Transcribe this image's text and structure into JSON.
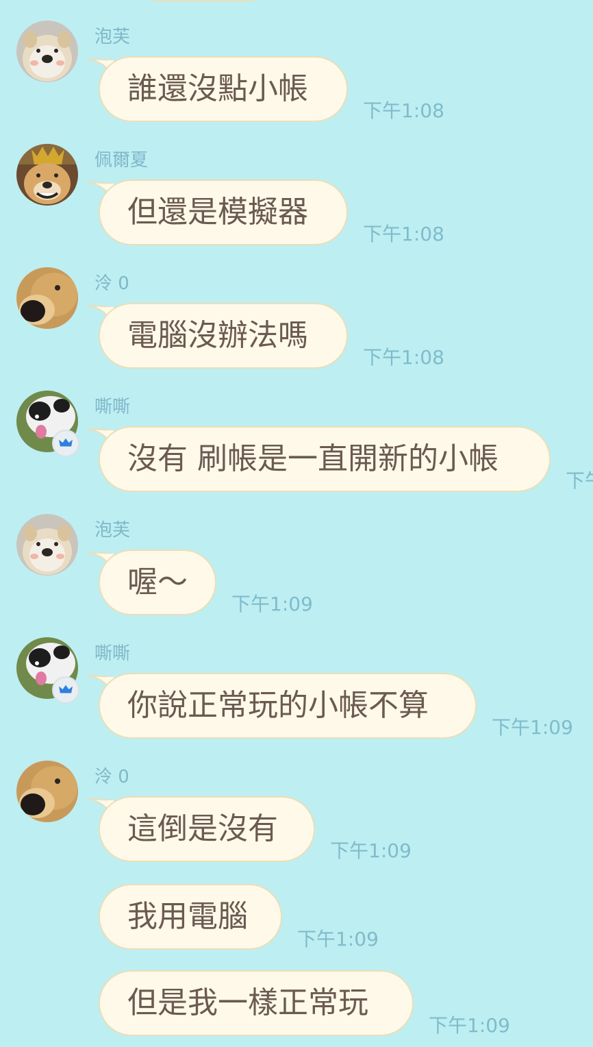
{
  "messages": [
    {
      "sender": "泡芙",
      "text": "誰還沒點小帳",
      "time": "下午1:08",
      "avatar": "dog-bread-avatar"
    },
    {
      "sender": "佩爾夏",
      "text": "但還是模擬器",
      "time": "下午1:08",
      "avatar": "dog-crown-avatar"
    },
    {
      "sender": "泠 0",
      "text": "電腦沒辦法嗎",
      "time": "下午1:08",
      "avatar": "dog-nose-avatar"
    },
    {
      "sender": "嘶嘶",
      "text": "沒有 刷帳是一直開新的小帳",
      "time": "下午",
      "avatar": "dog-bw-avatar",
      "badge": "crown-icon"
    },
    {
      "sender": "泡芙",
      "text": "喔～",
      "time": "下午1:09",
      "avatar": "dog-bread-avatar"
    },
    {
      "sender": "嘶嘶",
      "text": "你說正常玩的小帳不算",
      "time": "下午1:09",
      "avatar": "dog-bw-avatar",
      "badge": "crown-icon"
    },
    {
      "sender": "泠 0",
      "text": "這倒是沒有",
      "time": "下午1:09",
      "avatar": "dog-nose-avatar"
    },
    {
      "sender": "",
      "text": "我用電腦",
      "time": "下午1:09"
    },
    {
      "sender": "",
      "text": "但是我一樣正常玩",
      "time": "下午1:09"
    }
  ],
  "colors": {
    "background": "#bdeef2",
    "bubble": "#fff9ea",
    "bubble_border": "#eadfb8",
    "text": "#6b5a50",
    "name": "#7fb8c8",
    "time": "#7fbccb",
    "badge_crown": "#2f7fe0"
  }
}
